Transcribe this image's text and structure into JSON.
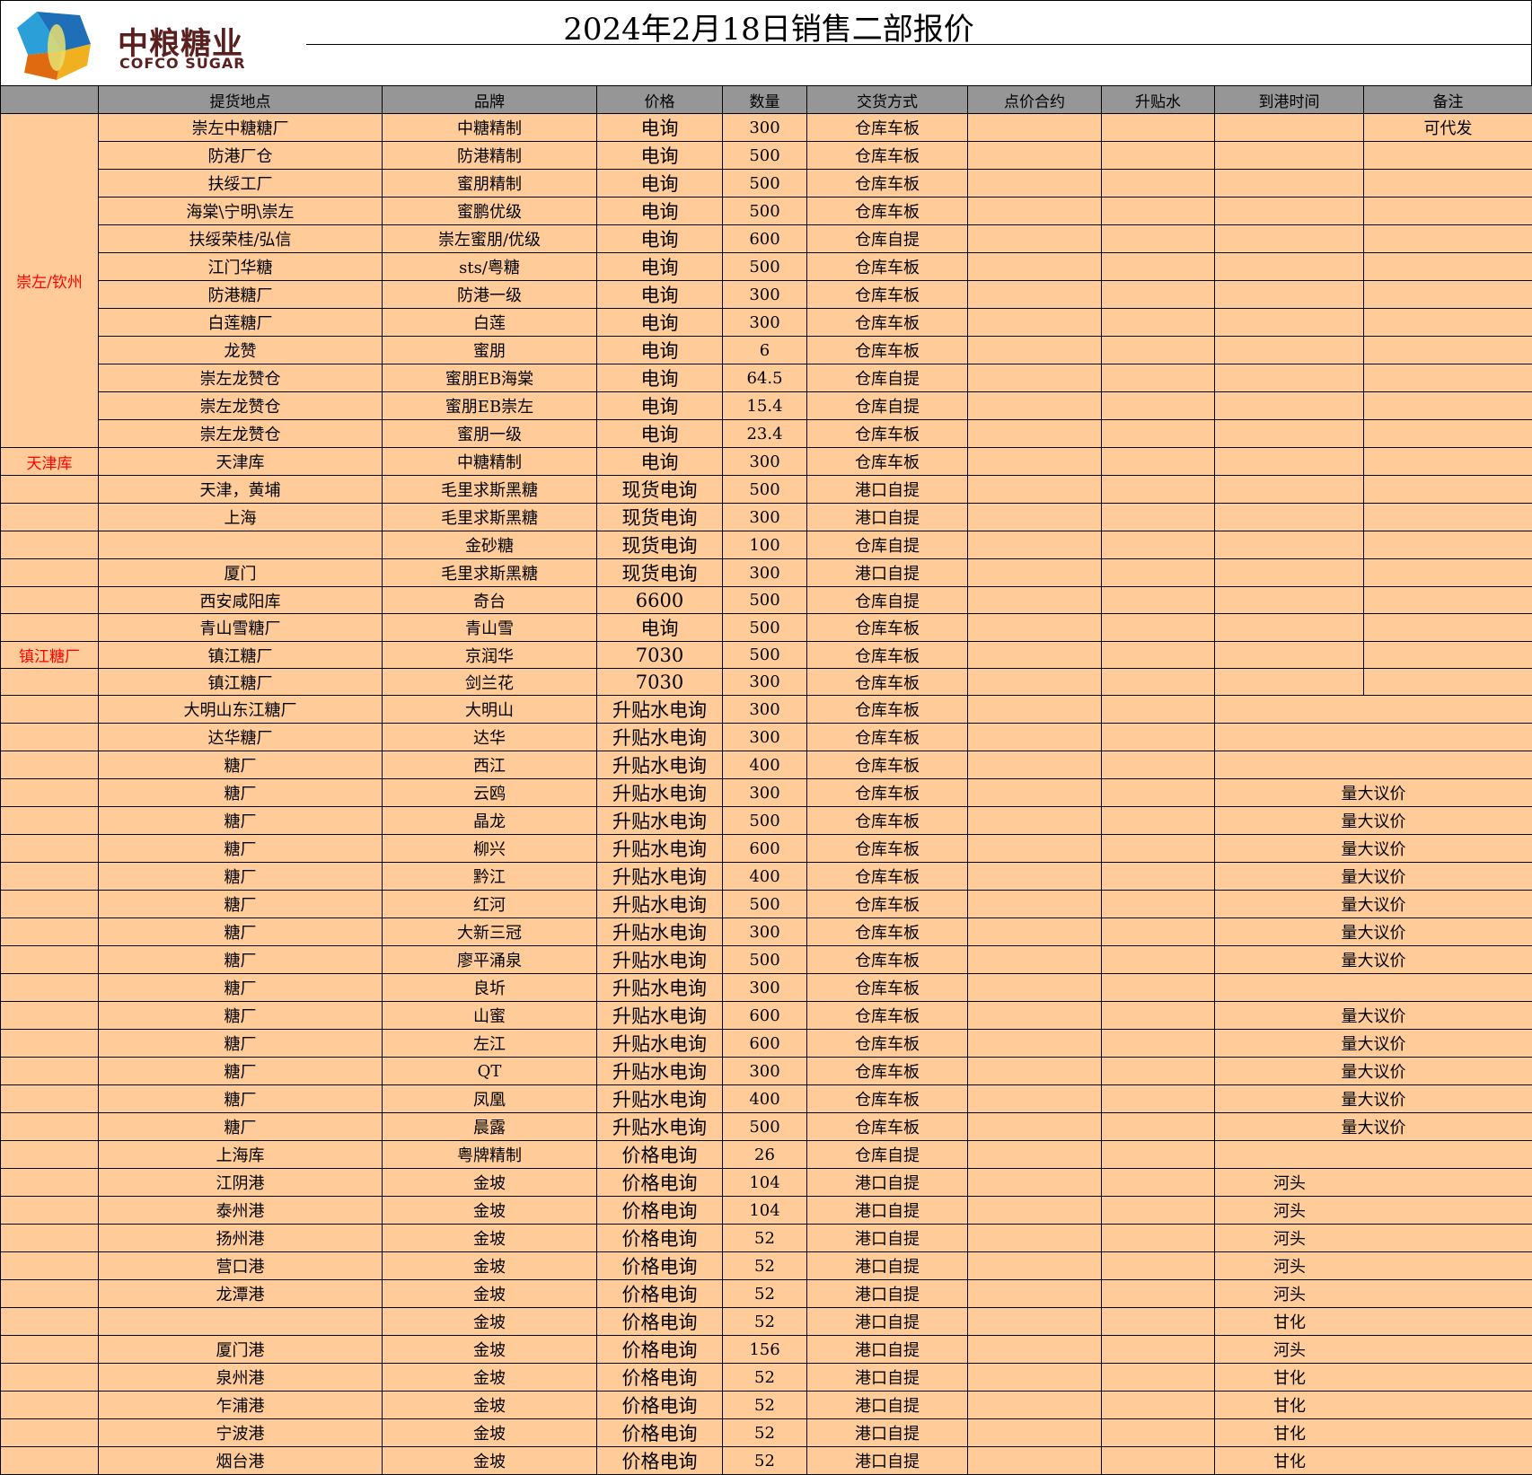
{
  "logo": {
    "cn": "中粮糖业",
    "en": "COFCO SUGAR"
  },
  "title": "2024年2月18日销售二部报价",
  "colors": {
    "header_bg": "#969696",
    "cell_bg": "#FFCC99",
    "region_text": "#FF0000"
  },
  "columns": [
    "",
    "提货地点",
    "品牌",
    "价格",
    "数量",
    "交货方式",
    "点价合约",
    "升贴水",
    "到港时间",
    "备注"
  ],
  "rows": [
    {
      "region": "崇左/钦州",
      "location": "崇左中糖糖厂",
      "brand": "中糖精制",
      "price": "电询",
      "qty": "300",
      "delivery": "仓库车板",
      "note": "可代发"
    },
    {
      "location": "防港厂仓",
      "brand": "防港精制",
      "price": "电询",
      "qty": "500",
      "delivery": "仓库车板"
    },
    {
      "location": "扶绥工厂",
      "brand": "蜜朋精制",
      "price": "电询",
      "qty": "500",
      "delivery": "仓库车板"
    },
    {
      "location": "海棠\\宁明\\崇左",
      "brand": "蜜鹏优级",
      "price": "电询",
      "qty": "500",
      "delivery": "仓库车板"
    },
    {
      "location": "扶绥荣桂/弘信",
      "brand": "崇左蜜朋/优级",
      "price": "电询",
      "qty": "600",
      "delivery": "仓库自提"
    },
    {
      "location": "江门华糖",
      "brand": "sts/粤糖",
      "price": "电询",
      "qty": "500",
      "delivery": "仓库车板"
    },
    {
      "location": "防港糖厂",
      "brand": "防港一级",
      "price": "电询",
      "qty": "300",
      "delivery": "仓库车板"
    },
    {
      "location": "白莲糖厂",
      "brand": "白莲",
      "price": "电询",
      "qty": "300",
      "delivery": "仓库车板"
    },
    {
      "location": "龙赞",
      "brand": "蜜朋",
      "price": "电询",
      "qty": "6",
      "delivery": "仓库车板"
    },
    {
      "location": "崇左龙赞仓",
      "brand": "蜜朋EB海棠",
      "price": "电询",
      "qty": "64.5",
      "delivery": "仓库自提"
    },
    {
      "location": "崇左龙赞仓",
      "brand": "蜜朋EB崇左",
      "price": "电询",
      "qty": "15.4",
      "delivery": "仓库自提"
    },
    {
      "location": "崇左龙赞仓",
      "brand": "蜜朋一级",
      "price": "电询",
      "qty": "23.4",
      "delivery": "仓库车板"
    },
    {
      "region": "天津库",
      "location": "天津库",
      "brand": "中糖精制",
      "price": "电询",
      "qty": "300",
      "delivery": "仓库车板"
    },
    {
      "location": "天津，黄埔",
      "brand": "毛里求斯黑糖",
      "price": "现货电询",
      "qty": "500",
      "delivery": "港口自提"
    },
    {
      "location": "上海",
      "brand": "毛里求斯黑糖",
      "price": "现货电询",
      "qty": "300",
      "delivery": "港口自提"
    },
    {
      "location": "",
      "brand": "金砂糖",
      "price": "现货电询",
      "qty": "100",
      "delivery": "仓库自提"
    },
    {
      "location": "厦门",
      "brand": "毛里求斯黑糖",
      "price": "现货电询",
      "qty": "300",
      "delivery": "港口自提"
    },
    {
      "location": "西安咸阳库",
      "brand": "奇台",
      "price": "6600",
      "qty": "500",
      "delivery": "仓库自提"
    },
    {
      "location": "青山雪糖厂",
      "brand": "青山雪",
      "price": "电询",
      "qty": "500",
      "delivery": "仓库车板"
    },
    {
      "region": "镇江糖厂",
      "location": "镇江糖厂",
      "brand": "京润华",
      "price": "7030",
      "qty": "500",
      "delivery": "仓库车板"
    },
    {
      "location": "镇江糖厂",
      "brand": "剑兰花",
      "price": "7030",
      "qty": "300",
      "delivery": "仓库车板"
    },
    {
      "location": "大明山东江糖厂",
      "brand": "大明山",
      "price": "升贴水电询",
      "qty": "300",
      "delivery": "仓库车板"
    },
    {
      "location": "达华糖厂",
      "brand": "达华",
      "price": "升贴水电询",
      "qty": "300",
      "delivery": "仓库车板"
    },
    {
      "location": "糖厂",
      "brand": "西江",
      "price": "升贴水电询",
      "qty": "400",
      "delivery": "仓库车板"
    },
    {
      "location": "糖厂",
      "brand": "云鸥",
      "price": "升贴水电询",
      "qty": "300",
      "delivery": "仓库车板",
      "note": "量大议价"
    },
    {
      "location": "糖厂",
      "brand": "晶龙",
      "price": "升贴水电询",
      "qty": "500",
      "delivery": "仓库车板",
      "note": "量大议价"
    },
    {
      "location": "糖厂",
      "brand": "柳兴",
      "price": "升贴水电询",
      "qty": "600",
      "delivery": "仓库车板",
      "note": "量大议价"
    },
    {
      "location": "糖厂",
      "brand": "黔江",
      "price": "升贴水电询",
      "qty": "400",
      "delivery": "仓库车板",
      "note": "量大议价"
    },
    {
      "location": "糖厂",
      "brand": "红河",
      "price": "升贴水电询",
      "qty": "500",
      "delivery": "仓库车板",
      "note": "量大议价"
    },
    {
      "location": "糖厂",
      "brand": "大新三冠",
      "price": "升贴水电询",
      "qty": "300",
      "delivery": "仓库车板",
      "note": "量大议价"
    },
    {
      "location": "糖厂",
      "brand": "廖平涌泉",
      "price": "升贴水电询",
      "qty": "500",
      "delivery": "仓库车板",
      "note": "量大议价"
    },
    {
      "location": "糖厂",
      "brand": "良圻",
      "price": "升贴水电询",
      "qty": "300",
      "delivery": "仓库车板"
    },
    {
      "location": "糖厂",
      "brand": "山蜜",
      "price": "升贴水电询",
      "qty": "600",
      "delivery": "仓库车板",
      "note": "量大议价"
    },
    {
      "location": "糖厂",
      "brand": "左江",
      "price": "升贴水电询",
      "qty": "600",
      "delivery": "仓库车板",
      "note": "量大议价"
    },
    {
      "location": "糖厂",
      "brand": "QT",
      "price": "升贴水电询",
      "qty": "300",
      "delivery": "仓库车板",
      "note": "量大议价"
    },
    {
      "location": "糖厂",
      "brand": "凤凰",
      "price": "升贴水电询",
      "qty": "400",
      "delivery": "仓库车板",
      "note": "量大议价"
    },
    {
      "location": "糖厂",
      "brand": "晨露",
      "price": "升贴水电询",
      "qty": "500",
      "delivery": "仓库车板",
      "note": "量大议价"
    },
    {
      "location": "上海库",
      "brand": "粤牌精制",
      "price": "价格电询",
      "qty": "26",
      "delivery": "仓库自提"
    },
    {
      "location": "江阴港",
      "brand": "金坡",
      "price": "价格电询",
      "qty": "104",
      "delivery": "港口自提",
      "port_time": "河头"
    },
    {
      "location": "泰州港",
      "brand": "金坡",
      "price": "价格电询",
      "qty": "104",
      "delivery": "港口自提",
      "port_time": "河头"
    },
    {
      "location": "扬州港",
      "brand": "金坡",
      "price": "价格电询",
      "qty": "52",
      "delivery": "港口自提",
      "port_time": "河头"
    },
    {
      "location": "营口港",
      "brand": "金坡",
      "price": "价格电询",
      "qty": "52",
      "delivery": "港口自提",
      "port_time": "河头"
    },
    {
      "location": "龙潭港",
      "brand": "金坡",
      "price": "价格电询",
      "qty": "52",
      "delivery": "港口自提",
      "port_time": "河头"
    },
    {
      "location": "",
      "brand": "金坡",
      "price": "价格电询",
      "qty": "52",
      "delivery": "港口自提",
      "port_time": "甘化"
    },
    {
      "location": "厦门港",
      "brand": "金坡",
      "price": "价格电询",
      "qty": "156",
      "delivery": "港口自提",
      "port_time": "河头"
    },
    {
      "location": "泉州港",
      "brand": "金坡",
      "price": "价格电询",
      "qty": "52",
      "delivery": "港口自提",
      "port_time": "甘化"
    },
    {
      "location": "乍浦港",
      "brand": "金坡",
      "price": "价格电询",
      "qty": "52",
      "delivery": "港口自提",
      "port_time": "甘化"
    },
    {
      "location": "宁波港",
      "brand": "金坡",
      "price": "价格电询",
      "qty": "52",
      "delivery": "港口自提",
      "port_time": "甘化"
    },
    {
      "location": "烟台港",
      "brand": "金坡",
      "price": "价格电询",
      "qty": "52",
      "delivery": "港口自提",
      "port_time": "甘化"
    }
  ]
}
